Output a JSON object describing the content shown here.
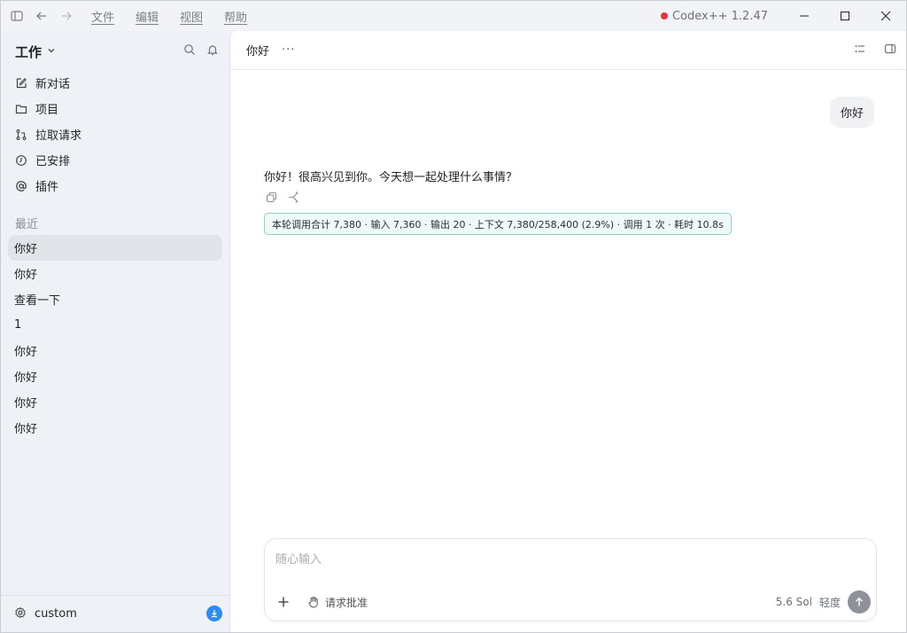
{
  "titlebar": {
    "menu": [
      "文件",
      "编辑",
      "视图",
      "帮助"
    ],
    "app_title": "Codex++ 1.2.47",
    "status_color": "#e5363b"
  },
  "sidebar": {
    "workspace": "工作",
    "nav": [
      {
        "label": "新对话",
        "icon": "edit-icon"
      },
      {
        "label": "项目",
        "icon": "folder-icon"
      },
      {
        "label": "拉取请求",
        "icon": "pull-request-icon"
      },
      {
        "label": "已安排",
        "icon": "clock-icon"
      },
      {
        "label": "插件",
        "icon": "at-icon"
      }
    ],
    "recent_label": "最近",
    "recent": [
      "你好",
      "你好",
      "查看一下",
      "1",
      "你好",
      "你好",
      "你好",
      "你好"
    ],
    "footer_label": "custom",
    "accent": "#2f8bf2"
  },
  "main": {
    "title": "你好",
    "more": "···",
    "user_message": "你好",
    "assistant_message": "你好！很高兴见到你。今天想一起处理什么事情？",
    "usage": "本轮调用合计 7,380 · 输入 7,360 · 输出 20 · 上下文 7,380/258,400 (2.9%) · 调用 1 次 · 耗时 10.8s",
    "composer": {
      "placeholder": "随心输入",
      "approve_label": "请求批准",
      "model": "5.6 Sol",
      "effort": "轻度"
    }
  }
}
